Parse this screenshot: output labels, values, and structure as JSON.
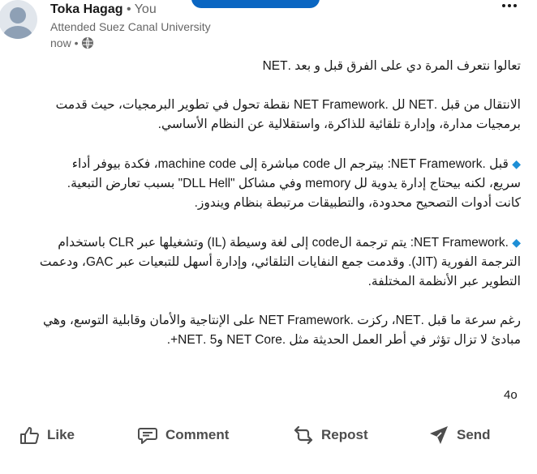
{
  "post": {
    "author": "Toka Hagag",
    "you_badge": "• You",
    "headline": "Attended Suez Canal University",
    "time": "now •",
    "paragraphs": [
      [
        "تعالوا نتعرف المرة دي على الفرق قبل و بعد .NET"
      ],
      [
        "الانتقال من قبل .NET لل .NET Framework نقطة تحول في تطوير البرمجيات، حيث قدمت",
        "برمجيات مدارة، وإدارة تلقائية للذاكرة، واستقلالية عن النظام الأساسي."
      ],
      [
        "قبل .NET Framework: بيترجم ال code مباشرة إلى machine code، فكدة بيوفر أداء",
        "سريع، لكنه بيحتاج إدارة يدوية لل memory وفي مشاكل \"DLL Hell\" بسبب تعارض التبعية.",
        "كانت أدوات التصحيح محدودة، والتطبيقات مرتبطة بنظام ويندوز."
      ],
      [
        ".NET Framework: يتم ترجمة الcode إلى لغة وسيطة (IL) وتشغيلها عبر CLR باستخدام",
        "الترجمة الفورية (JIT). وقدمت جمع النفايات التلقائي، وإدارة أسهل للتبعيات عبر GAC، ودعمت",
        "التطوير عبر الأنظمة المختلفة."
      ],
      [
        "رغم سرعة ما قبل .NET، ركزت .NET Framework على الإنتاجية والأمان وقابلية التوسع، وهي",
        "مبادئ لا تزال تؤثر في أطر العمل الحديثة مثل .NET Core و5 .NET+."
      ]
    ],
    "diamond_glyph": "◆",
    "reaction_count": "4o"
  },
  "actions": {
    "like": "Like",
    "comment": "Comment",
    "repost": "Repost",
    "send": "Send"
  },
  "colors": {
    "accent": "#0a66c2",
    "diamond": "#1e8fd6",
    "text": "#191919",
    "muted": "#666666"
  }
}
